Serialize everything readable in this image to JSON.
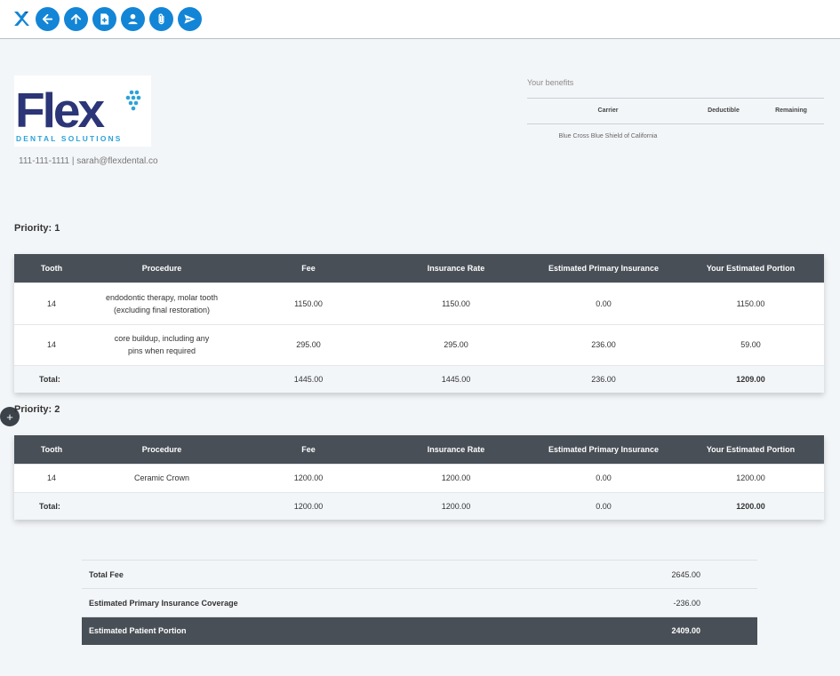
{
  "colors": {
    "toolbar_accent": "#1385d6",
    "table_header": "#484f57",
    "logo_navy": "#2b3577",
    "logo_cyan": "#2aa3d8"
  },
  "toolbar": {
    "buttons": [
      {
        "name": "back-button",
        "icon": "arrow-left-icon"
      },
      {
        "name": "upload-button",
        "icon": "arrow-up-icon"
      },
      {
        "name": "add-document-button",
        "icon": "document-plus-icon"
      },
      {
        "name": "patient-button",
        "icon": "user-icon"
      },
      {
        "name": "attach-button",
        "icon": "paperclip-icon"
      },
      {
        "name": "send-button",
        "icon": "send-icon"
      }
    ]
  },
  "practice": {
    "logo_word": "Flex",
    "logo_sub": "DENTAL SOLUTIONS",
    "contact": "111-111-1111 | sarah@flexdental.co"
  },
  "benefits": {
    "title": "Your benefits",
    "headers": [
      "Carrier",
      "Deductible",
      "Remaining"
    ],
    "rows": [
      [
        "Blue Cross Blue Shield of California",
        "",
        ""
      ]
    ]
  },
  "plan": {
    "headers": [
      "Tooth",
      "Procedure",
      "Fee",
      "Insurance Rate",
      "Estimated Primary Insurance",
      "Your Estimated Portion"
    ],
    "priorities": [
      {
        "label": "Priority: 1",
        "rows": [
          [
            "14",
            "endodontic therapy, molar tooth (excluding final restoration)",
            "1150.00",
            "1150.00",
            "0.00",
            "1150.00"
          ],
          [
            "14",
            "core buildup, including any pins when required",
            "295.00",
            "295.00",
            "236.00",
            "59.00"
          ]
        ],
        "total": [
          "Total:",
          "1445.00",
          "1445.00",
          "236.00",
          "1209.00"
        ]
      },
      {
        "label": "Priority: 2",
        "rows": [
          [
            "14",
            "Ceramic Crown",
            "1200.00",
            "1200.00",
            "0.00",
            "1200.00"
          ]
        ],
        "total": [
          "Total:",
          "1200.00",
          "1200.00",
          "0.00",
          "1200.00"
        ]
      }
    ]
  },
  "summary": {
    "total_fee_label": "Total Fee",
    "total_fee": "2645.00",
    "coverage_label": "Estimated Primary Insurance Coverage",
    "coverage": "-236.00",
    "patient_label": "Estimated Patient Portion",
    "patient": "2409.00"
  },
  "add_icon": "+"
}
